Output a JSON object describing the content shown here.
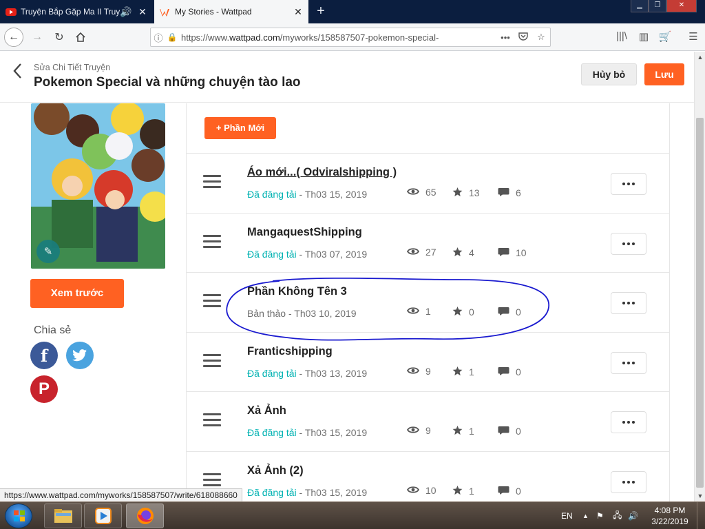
{
  "browser": {
    "tabs": [
      {
        "title": "Truyện Bắp Gặp Ma II Truyện",
        "active": false,
        "favicon": "youtube-icon"
      },
      {
        "title": "My Stories - Wattpad",
        "active": true,
        "favicon": "wattpad-icon"
      }
    ],
    "url_prefix": "https://www.",
    "url_host": "wattpad.com",
    "url_path": "/myworks/158587507-pokemon-special-",
    "status_url": "https://www.wattpad.com/myworks/158587507/write/618088660"
  },
  "header": {
    "breadcrumb": "Sửa Chi Tiết Truyện",
    "story_title": "Pokemon Special và những chuyện tào lao",
    "cancel_label": "Hủy bỏ",
    "save_label": "Lưu"
  },
  "sidebar": {
    "preview_label": "Xem trước",
    "share_label": "Chia sẻ",
    "social": [
      "facebook-icon",
      "twitter-icon",
      "pinterest-icon"
    ]
  },
  "parts": {
    "new_part_label": "+ Phần Mới",
    "items": [
      {
        "title": "Áo mới...( Odviralshipping )",
        "status": "Đã đăng tải",
        "published": true,
        "date": "Th03 15, 2019",
        "views": "65",
        "stars": "13",
        "comments": "6"
      },
      {
        "title": "MangaquestShipping",
        "status": "Đã đăng tải",
        "published": true,
        "date": "Th03 07, 2019",
        "views": "27",
        "stars": "4",
        "comments": "10"
      },
      {
        "title": "Phần Không Tên 3",
        "status": "Bản thảo",
        "published": false,
        "date": "Th03 10, 2019",
        "views": "1",
        "stars": "0",
        "comments": "0"
      },
      {
        "title": "Franticshipping",
        "status": "Đã đăng tải",
        "published": true,
        "date": "Th03 13, 2019",
        "views": "9",
        "stars": "1",
        "comments": "0"
      },
      {
        "title": "Xả Ảnh",
        "status": "Đã đăng tải",
        "published": true,
        "date": "Th03 15, 2019",
        "views": "9",
        "stars": "1",
        "comments": "0"
      },
      {
        "title": "Xả Ảnh (2)",
        "status": "Đã đăng tải",
        "published": true,
        "date": "Th03 15, 2019",
        "views": "10",
        "stars": "1",
        "comments": "0"
      }
    ]
  },
  "taskbar": {
    "language": "EN",
    "time": "4:08 PM",
    "date": "3/22/2019"
  },
  "colors": {
    "accent": "#ff6122",
    "published": "#00b2b2",
    "annotation": "#1a1acf"
  }
}
